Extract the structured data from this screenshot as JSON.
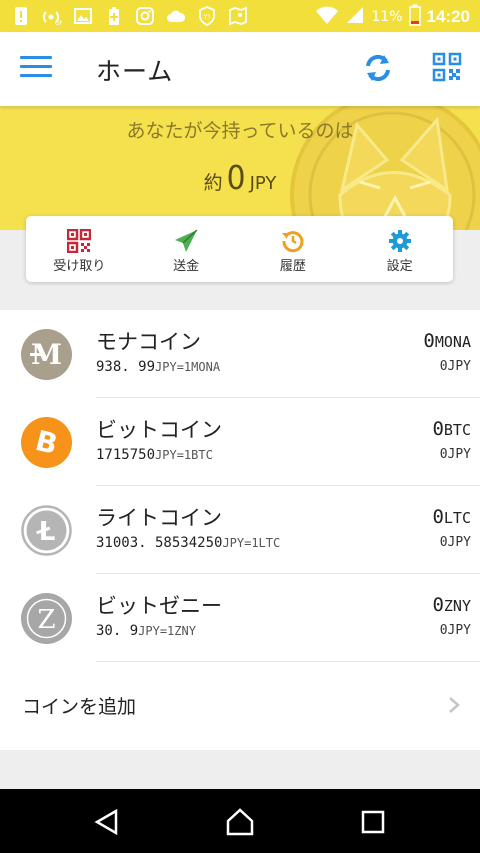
{
  "status_bar": {
    "icons": [
      "alert-icon",
      "hotspot-icon",
      "image-icon",
      "battery-plus-icon",
      "instagram-icon",
      "cloud-icon",
      "shield-icon",
      "map-icon"
    ],
    "battery": "11%",
    "time": "14:20"
  },
  "header": {
    "title": "ホーム"
  },
  "summary": {
    "label": "あなたが今持っているのは",
    "prefix": "約",
    "amount": "0",
    "unit": "JPY"
  },
  "actions": [
    {
      "label": "受け取り",
      "icon": "qr-receive-icon"
    },
    {
      "label": "送金",
      "icon": "send-icon"
    },
    {
      "label": "履歴",
      "icon": "history-icon"
    },
    {
      "label": "設定",
      "icon": "settings-icon"
    }
  ],
  "coins": [
    {
      "name": "モナコイン",
      "rate": "938. 99",
      "rate_unit": "JPY=1MONA",
      "amount": "0",
      "symbol": "MONA",
      "jpy": "0JPY",
      "logo_color": "#a89f8c",
      "logo": "M"
    },
    {
      "name": "ビットコイン",
      "rate": "1715750",
      "rate_unit": "JPY=1BTC",
      "amount": "0",
      "symbol": "BTC",
      "jpy": "0JPY",
      "logo_color": "#f7931a",
      "logo": "B"
    },
    {
      "name": "ライトコイン",
      "rate": "31003. 58534250",
      "rate_unit": "JPY=1LTC",
      "amount": "0",
      "symbol": "LTC",
      "jpy": "0JPY",
      "logo_color": "#b5b5b5",
      "logo": "L"
    },
    {
      "name": "ビットゼニー",
      "rate": "30. 9",
      "rate_unit": "JPY=1ZNY",
      "amount": "0",
      "symbol": "ZNY",
      "jpy": "0JPY",
      "logo_color": "#a7a7a7",
      "logo": "Z"
    }
  ],
  "add_coin": {
    "label": "コインを追加"
  },
  "colors": {
    "status_bar": "#f3df3c",
    "hero": "#f5e04e",
    "accent_blue": "#2b8ee6",
    "receive_red": "#c62838",
    "send_green": "#4caf50",
    "history_orange": "#f0a020",
    "settings_blue": "#1e9ad6"
  }
}
